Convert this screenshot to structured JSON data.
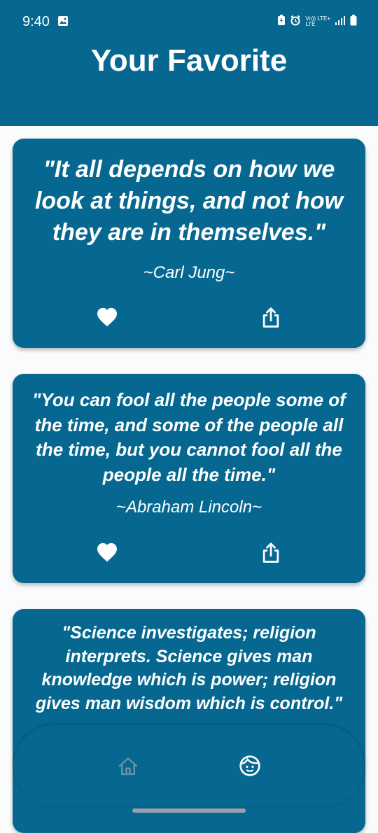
{
  "status_bar": {
    "time": "9:40",
    "network_top": "Vo)) LTE+",
    "network_bottom": "LTE"
  },
  "header": {
    "title": "Your Favorite"
  },
  "quotes": [
    {
      "text": "\"It all depends on how we look at things, and not how they are in themselves.\"",
      "author": "~Carl Jung~"
    },
    {
      "text": "\"You can fool all the people some of the time, and some of the people all the time, but you cannot fool all the people all the time.\"",
      "author": "~Abraham Lincoln~"
    },
    {
      "text": "\"Science investigates; religion interprets. Science gives man knowledge which is power; religion gives man wisdom which is control.\"",
      "author": ""
    }
  ],
  "icons": {
    "favorite": "heart-icon",
    "share": "share-icon",
    "home": "home-icon",
    "profile": "profile-face-icon"
  },
  "colors": {
    "primary": "#066890",
    "background": "#fafbfc",
    "text_on_primary": "#ffffff",
    "nav_inactive": "#6b8fa3"
  }
}
